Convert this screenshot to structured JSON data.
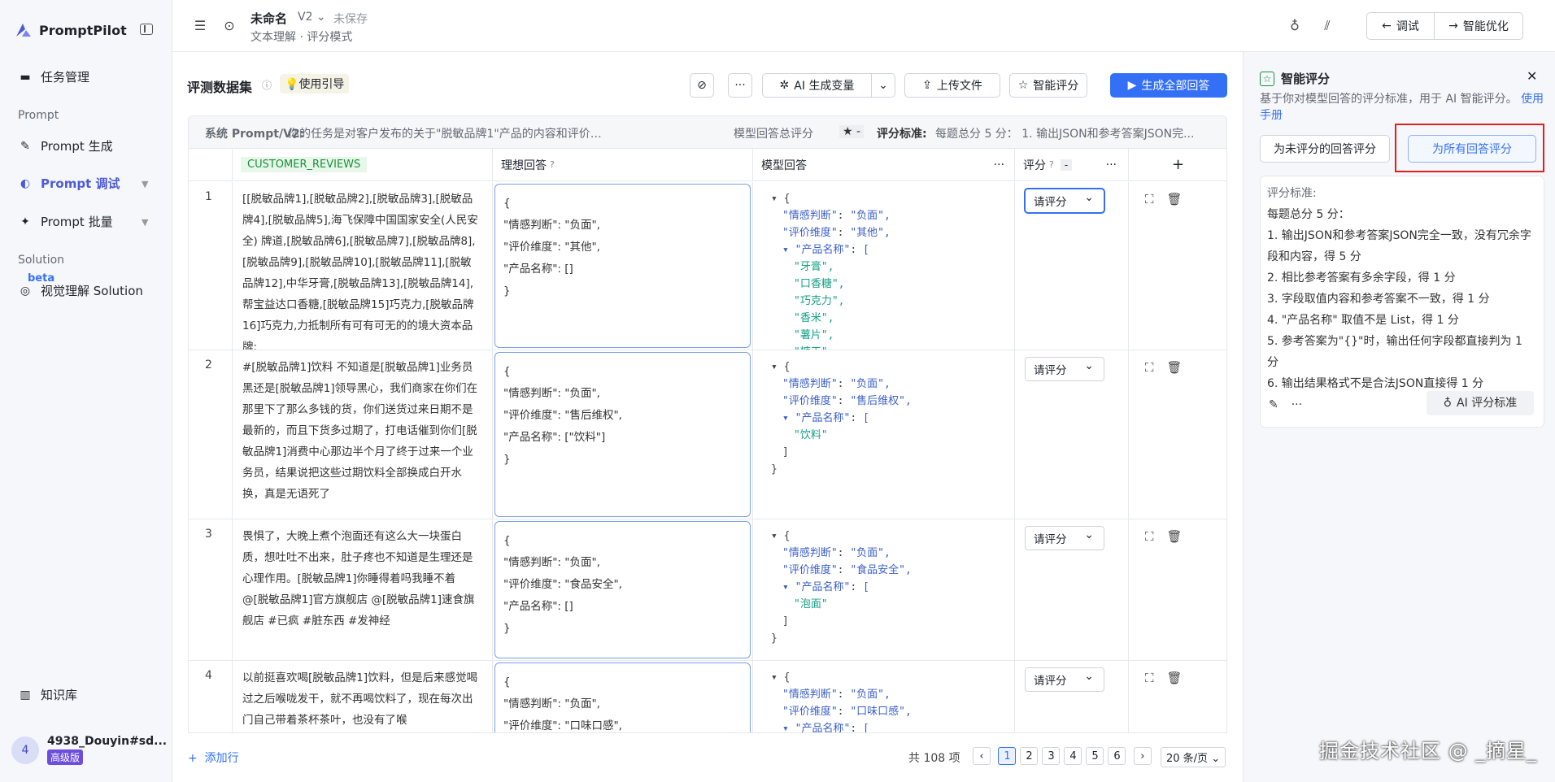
{
  "sidebar": {
    "logo": "PromptPilot",
    "items": [
      {
        "label": "任务管理"
      },
      {
        "section": "Prompt"
      },
      {
        "label": "Prompt 生成"
      },
      {
        "label": "Prompt 调试"
      },
      {
        "label": "Prompt 批量"
      },
      {
        "section": "Solution"
      },
      {
        "label": "视觉理解 Solution",
        "badge": "beta"
      },
      {
        "label": "知识库"
      }
    ],
    "user": {
      "initial": "4",
      "name": "4938_Douyin#sd...",
      "tier": "高级版"
    }
  },
  "topbar": {
    "title": "未命名",
    "version": "V2",
    "save_status": "未保存",
    "subtitle": "文本理解 · 评分模式",
    "debug_label": "调试",
    "optimize_label": "智能优化"
  },
  "main": {
    "dataset_title": "评测数据集",
    "guide_label": "使用引导",
    "ai_var_label": "AI 生成变量",
    "upload_label": "上传文件",
    "smart_score_label": "智能评分",
    "generate_all_label": "生成全部回答",
    "info": {
      "system_prompt": "系统 Prompt/V2:",
      "system_prompt_text": "你的任务是对客户发布的关于\"脱敏品牌1\"产品的内容和评价进行识...",
      "model_total": "模型回答总评分",
      "model_total_value": "★ -",
      "criteria_label": "评分标准:",
      "criteria_text": "每题总分 5 分： 1. 输出JSON和参考答案JSON完..."
    },
    "columns": {
      "reviews": "CUSTOMER_REVIEWS",
      "ideal": "理想回答",
      "model": "模型回答",
      "score": "评分",
      "score_value": "-"
    },
    "rows": [
      {
        "num": "1",
        "review": "[[脱敏品牌1],[脱敏品牌2],[脱敏品牌3],[脱敏品牌4],[脱敏品牌5],海飞保障中国国家安全(人民安全) 牌道,[脱敏品牌6],[脱敏品牌7],[脱敏品牌8],[脱敏品牌9],[脱敏品牌10],[脱敏品牌11],[脱敏品牌12],中华牙膏,[脱敏品牌13],[脱敏品牌14],帮宝益达口香糖,[脱敏品牌15]巧克力,[脱敏品牌16]巧克力,力抵制所有可有可无的的境大资本品牌;",
        "ideal": "{\n\"情感判断\": \"负面\",\n\"评价维度\": \"其他\",\n\"产品名称\": []\n}",
        "model": [
          {
            "t": "▾ {",
            "i": 0
          },
          {
            "k": "\"情感判断\"",
            "v": "\"负面\",",
            "i": 1
          },
          {
            "k": "\"评价维度\"",
            "v": "\"其他\",",
            "i": 1
          },
          {
            "k": "▾ \"产品名称\"",
            "v": "[",
            "i": 1
          },
          {
            "s": "\"牙膏\",",
            "i": 2
          },
          {
            "s": "\"口香糖\",",
            "i": 2
          },
          {
            "s": "\"巧克力\",",
            "i": 2
          },
          {
            "s": "\"香米\",",
            "i": 2
          },
          {
            "s": "\"薯片\",",
            "i": 2
          },
          {
            "s": "\"糖干\",",
            "i": 2
          }
        ],
        "score": "请评分"
      },
      {
        "num": "2",
        "review": "#[脱敏品牌1]饮料 不知道是[脱敏品牌1]业务员黑还是[脱敏品牌1]领导黑心，我们商家在你们在那里下了那么多钱的货，你们送货过来日期不是最新的，而且下货多过期了，打电话催到你们[脱敏品牌1]消费中心那边半个月了终于过来一个业务员，结果说把这些过期饮料全部换成白开水换，真是无语死了",
        "ideal": "{\n\"情感判断\": \"负面\",\n\"评价维度\": \"售后维权\",\n\"产品名称\": [\"饮料\"]\n}",
        "model": [
          {
            "t": "▾ {",
            "i": 0
          },
          {
            "k": "\"情感判断\"",
            "v": "\"负面\",",
            "i": 1
          },
          {
            "k": "\"评价维度\"",
            "v": "\"售后维权\",",
            "i": 1
          },
          {
            "k": "▾ \"产品名称\"",
            "v": "[",
            "i": 1
          },
          {
            "s": "\"饮料\"",
            "i": 2
          },
          {
            "t": "]",
            "i": 1
          },
          {
            "t": "}",
            "i": 0
          }
        ],
        "score": "请评分"
      },
      {
        "num": "3",
        "review": "畏惧了，大晚上煮个泡面还有这么大一块蛋白质，想吐吐不出来，肚子疼也不知道是生理还是心理作用。[脱敏品牌1]你睡得着吗我睡不着 @[脱敏品牌1]官方旗舰店 @[脱敏品牌1]速食旗舰店 #已疯 #脏东西 #发神经",
        "ideal": "{\n\"情感判断\": \"负面\",\n\"评价维度\": \"食品安全\",\n\"产品名称\": []\n}",
        "model": [
          {
            "t": "▾ {",
            "i": 0
          },
          {
            "k": "\"情感判断\"",
            "v": "\"负面\",",
            "i": 1
          },
          {
            "k": "\"评价维度\"",
            "v": "\"食品安全\",",
            "i": 1
          },
          {
            "k": "▾ \"产品名称\"",
            "v": "[",
            "i": 1
          },
          {
            "s": "\"泡面\"",
            "i": 2
          },
          {
            "t": "]",
            "i": 1
          },
          {
            "t": "}",
            "i": 0
          }
        ],
        "score": "请评分"
      },
      {
        "num": "4",
        "review": "以前挺喜欢喝[脱敏品牌1]饮料，但是后来感觉喝过之后喉咙发干，就不再喝饮料了，现在每次出门自己带着茶杯茶叶，也没有了喉",
        "ideal": "{\n\"情感判断\": \"负面\",\n\"评价维度\": \"口味口感\",\n}",
        "model": [
          {
            "t": "▾ {",
            "i": 0
          },
          {
            "k": "\"情感判断\"",
            "v": "\"负面\",",
            "i": 1
          },
          {
            "k": "\"评价维度\"",
            "v": "\"口味口感\",",
            "i": 1
          },
          {
            "k": "▾ \"产品名称\"",
            "v": "[",
            "i": 1
          }
        ],
        "score": "请评分"
      }
    ],
    "add_row_label": "添加行",
    "total_label": "共 108 项",
    "pages": [
      "1",
      "2",
      "3",
      "4",
      "5",
      "6"
    ],
    "page_size": "20 条/页"
  },
  "right_panel": {
    "title": "智能评分",
    "desc": "基于你对模型回答的评分标准，用于 AI 智能评分。",
    "manual_link": "使用手册",
    "btn_unscored": "为未评分的回答评分",
    "btn_all": "为所有回答评分",
    "criteria_title": "评分标准:",
    "criteria_lines": [
      "每题总分 5 分：",
      "1. 输出JSON和参考答案JSON完全一致，没有冗余字段和内容，得 5 分",
      "2. 相比参考答案有多余字段，得 1 分",
      "3. 字段取值内容和参考答案不一致，得 1 分",
      "4. \"产品名称\" 取值不是 List，得 1 分",
      "5. 参考答案为\"{}\"时，输出任何字段都直接判为 1 分",
      "6. 输出结果格式不是合法JSON直接得 1 分"
    ],
    "ai_criteria_label": "AI 评分标准"
  },
  "watermark": "掘金技术社区 @ _摘星_",
  "colors": {
    "primary": "#3470f5",
    "accent": "#4e5bd6",
    "highlight": "#e02020"
  }
}
